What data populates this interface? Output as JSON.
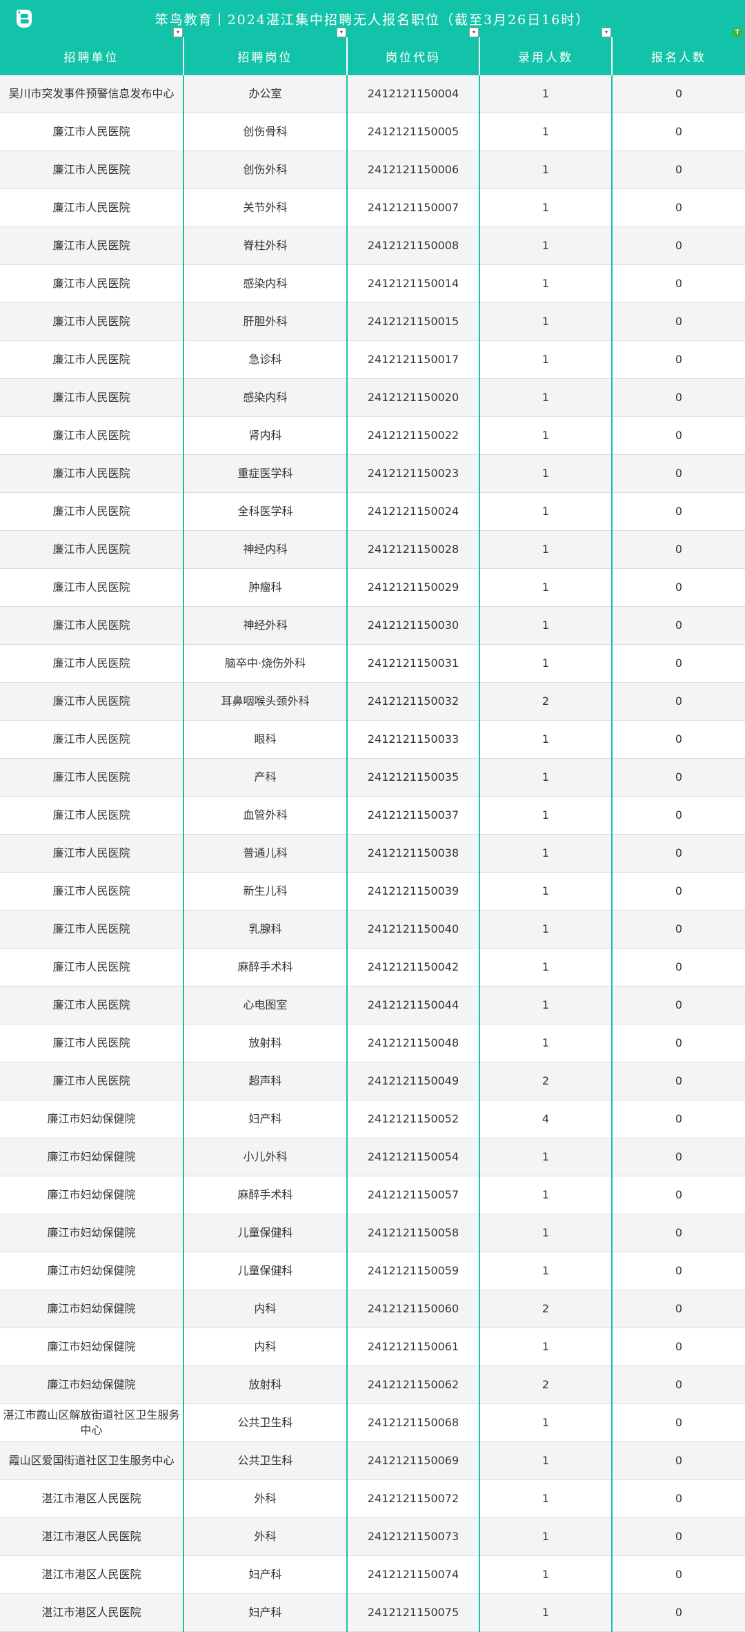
{
  "title": "笨鸟教育丨2024湛江集中招聘无人报名职位（截至3月26日16时）",
  "headers": [
    "招聘单位",
    "招聘岗位",
    "岗位代码",
    "录用人数",
    "报名人数"
  ],
  "rows": [
    [
      "吴川市突发事件预警信息发布中心",
      "办公室",
      "2412121150004",
      "1",
      "0"
    ],
    [
      "廉江市人民医院",
      "创伤骨科",
      "2412121150005",
      "1",
      "0"
    ],
    [
      "廉江市人民医院",
      "创伤外科",
      "2412121150006",
      "1",
      "0"
    ],
    [
      "廉江市人民医院",
      "关节外科",
      "2412121150007",
      "1",
      "0"
    ],
    [
      "廉江市人民医院",
      "脊柱外科",
      "2412121150008",
      "1",
      "0"
    ],
    [
      "廉江市人民医院",
      "感染内科",
      "2412121150014",
      "1",
      "0"
    ],
    [
      "廉江市人民医院",
      "肝胆外科",
      "2412121150015",
      "1",
      "0"
    ],
    [
      "廉江市人民医院",
      "急诊科",
      "2412121150017",
      "1",
      "0"
    ],
    [
      "廉江市人民医院",
      "感染内科",
      "2412121150020",
      "1",
      "0"
    ],
    [
      "廉江市人民医院",
      "肾内科",
      "2412121150022",
      "1",
      "0"
    ],
    [
      "廉江市人民医院",
      "重症医学科",
      "2412121150023",
      "1",
      "0"
    ],
    [
      "廉江市人民医院",
      "全科医学科",
      "2412121150024",
      "1",
      "0"
    ],
    [
      "廉江市人民医院",
      "神经内科",
      "2412121150028",
      "1",
      "0"
    ],
    [
      "廉江市人民医院",
      "肿瘤科",
      "2412121150029",
      "1",
      "0"
    ],
    [
      "廉江市人民医院",
      "神经外科",
      "2412121150030",
      "1",
      "0"
    ],
    [
      "廉江市人民医院",
      "脑卒中·烧伤外科",
      "2412121150031",
      "1",
      "0"
    ],
    [
      "廉江市人民医院",
      "耳鼻咽喉头颈外科",
      "2412121150032",
      "2",
      "0"
    ],
    [
      "廉江市人民医院",
      "眼科",
      "2412121150033",
      "1",
      "0"
    ],
    [
      "廉江市人民医院",
      "产科",
      "2412121150035",
      "1",
      "0"
    ],
    [
      "廉江市人民医院",
      "血管外科",
      "2412121150037",
      "1",
      "0"
    ],
    [
      "廉江市人民医院",
      "普通儿科",
      "2412121150038",
      "1",
      "0"
    ],
    [
      "廉江市人民医院",
      "新生儿科",
      "2412121150039",
      "1",
      "0"
    ],
    [
      "廉江市人民医院",
      "乳腺科",
      "2412121150040",
      "1",
      "0"
    ],
    [
      "廉江市人民医院",
      "麻醉手术科",
      "2412121150042",
      "1",
      "0"
    ],
    [
      "廉江市人民医院",
      "心电图室",
      "2412121150044",
      "1",
      "0"
    ],
    [
      "廉江市人民医院",
      "放射科",
      "2412121150048",
      "1",
      "0"
    ],
    [
      "廉江市人民医院",
      "超声科",
      "2412121150049",
      "2",
      "0"
    ],
    [
      "廉江市妇幼保健院",
      "妇产科",
      "2412121150052",
      "4",
      "0"
    ],
    [
      "廉江市妇幼保健院",
      "小儿外科",
      "2412121150054",
      "1",
      "0"
    ],
    [
      "廉江市妇幼保健院",
      "麻醉手术科",
      "2412121150057",
      "1",
      "0"
    ],
    [
      "廉江市妇幼保健院",
      "儿童保健科",
      "2412121150058",
      "1",
      "0"
    ],
    [
      "廉江市妇幼保健院",
      "儿童保健科",
      "2412121150059",
      "1",
      "0"
    ],
    [
      "廉江市妇幼保健院",
      "内科",
      "2412121150060",
      "2",
      "0"
    ],
    [
      "廉江市妇幼保健院",
      "内科",
      "2412121150061",
      "1",
      "0"
    ],
    [
      "廉江市妇幼保健院",
      "放射科",
      "2412121150062",
      "2",
      "0"
    ],
    [
      "湛江市霞山区解放街道社区卫生服务中心",
      "公共卫生科",
      "2412121150068",
      "1",
      "0"
    ],
    [
      "霞山区爱国街道社区卫生服务中心",
      "公共卫生科",
      "2412121150069",
      "1",
      "0"
    ],
    [
      "湛江市港区人民医院",
      "外科",
      "2412121150072",
      "1",
      "0"
    ],
    [
      "湛江市港区人民医院",
      "外科",
      "2412121150073",
      "1",
      "0"
    ],
    [
      "湛江市港区人民医院",
      "妇产科",
      "2412121150074",
      "1",
      "0"
    ],
    [
      "湛江市港区人民医院",
      "妇产科",
      "2412121150075",
      "1",
      "0"
    ]
  ],
  "icons": {
    "logo": "bird-logo-icon",
    "filter": "filter-dropdown-icon",
    "corner": "sheet-tag-icon"
  },
  "colors": {
    "accent": "#13c3a9",
    "stripe": "#f4f4f4"
  }
}
